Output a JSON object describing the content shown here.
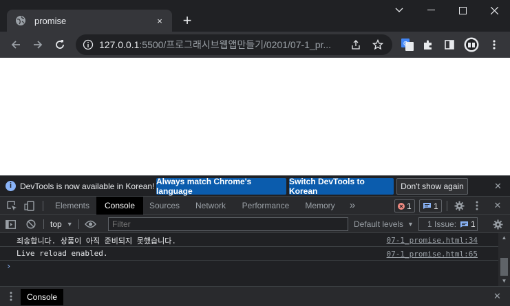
{
  "browser": {
    "tab_title": "promise",
    "tab_close": "×",
    "new_tab": "+",
    "url_host": "127.0.0.1",
    "url_path": ":5500/프로그래시브웹앱만들기/0201/07-1_pr..."
  },
  "infobar": {
    "message": "DevTools is now available in Korean!",
    "btn_match": "Always match Chrome's language",
    "btn_switch": "Switch DevTools to Korean",
    "btn_dont": "Don't show again",
    "close": "✕"
  },
  "devtools": {
    "tabs": [
      "Elements",
      "Console",
      "Sources",
      "Network",
      "Performance",
      "Memory"
    ],
    "more": "»",
    "error_count": "1",
    "message_count": "1",
    "close": "✕"
  },
  "filterbar": {
    "context": "top",
    "filter_placeholder": "Filter",
    "levels": "Default levels",
    "issues_label": "1 Issue:",
    "issues_count": "1"
  },
  "console": {
    "messages": [
      {
        "text": "죄송합니다. 상품이 아직 준비되지 못했습니다.",
        "source": "07-1_promise.html:34"
      },
      {
        "text": "Live reload enabled.",
        "source": "07-1_promise.html:65"
      }
    ],
    "prompt": "›"
  },
  "drawer": {
    "tab": "Console",
    "close": "✕"
  },
  "colors": {
    "accent": "#8ab4f8",
    "error": "#f28b82",
    "button_blue": "#0b5cad"
  }
}
